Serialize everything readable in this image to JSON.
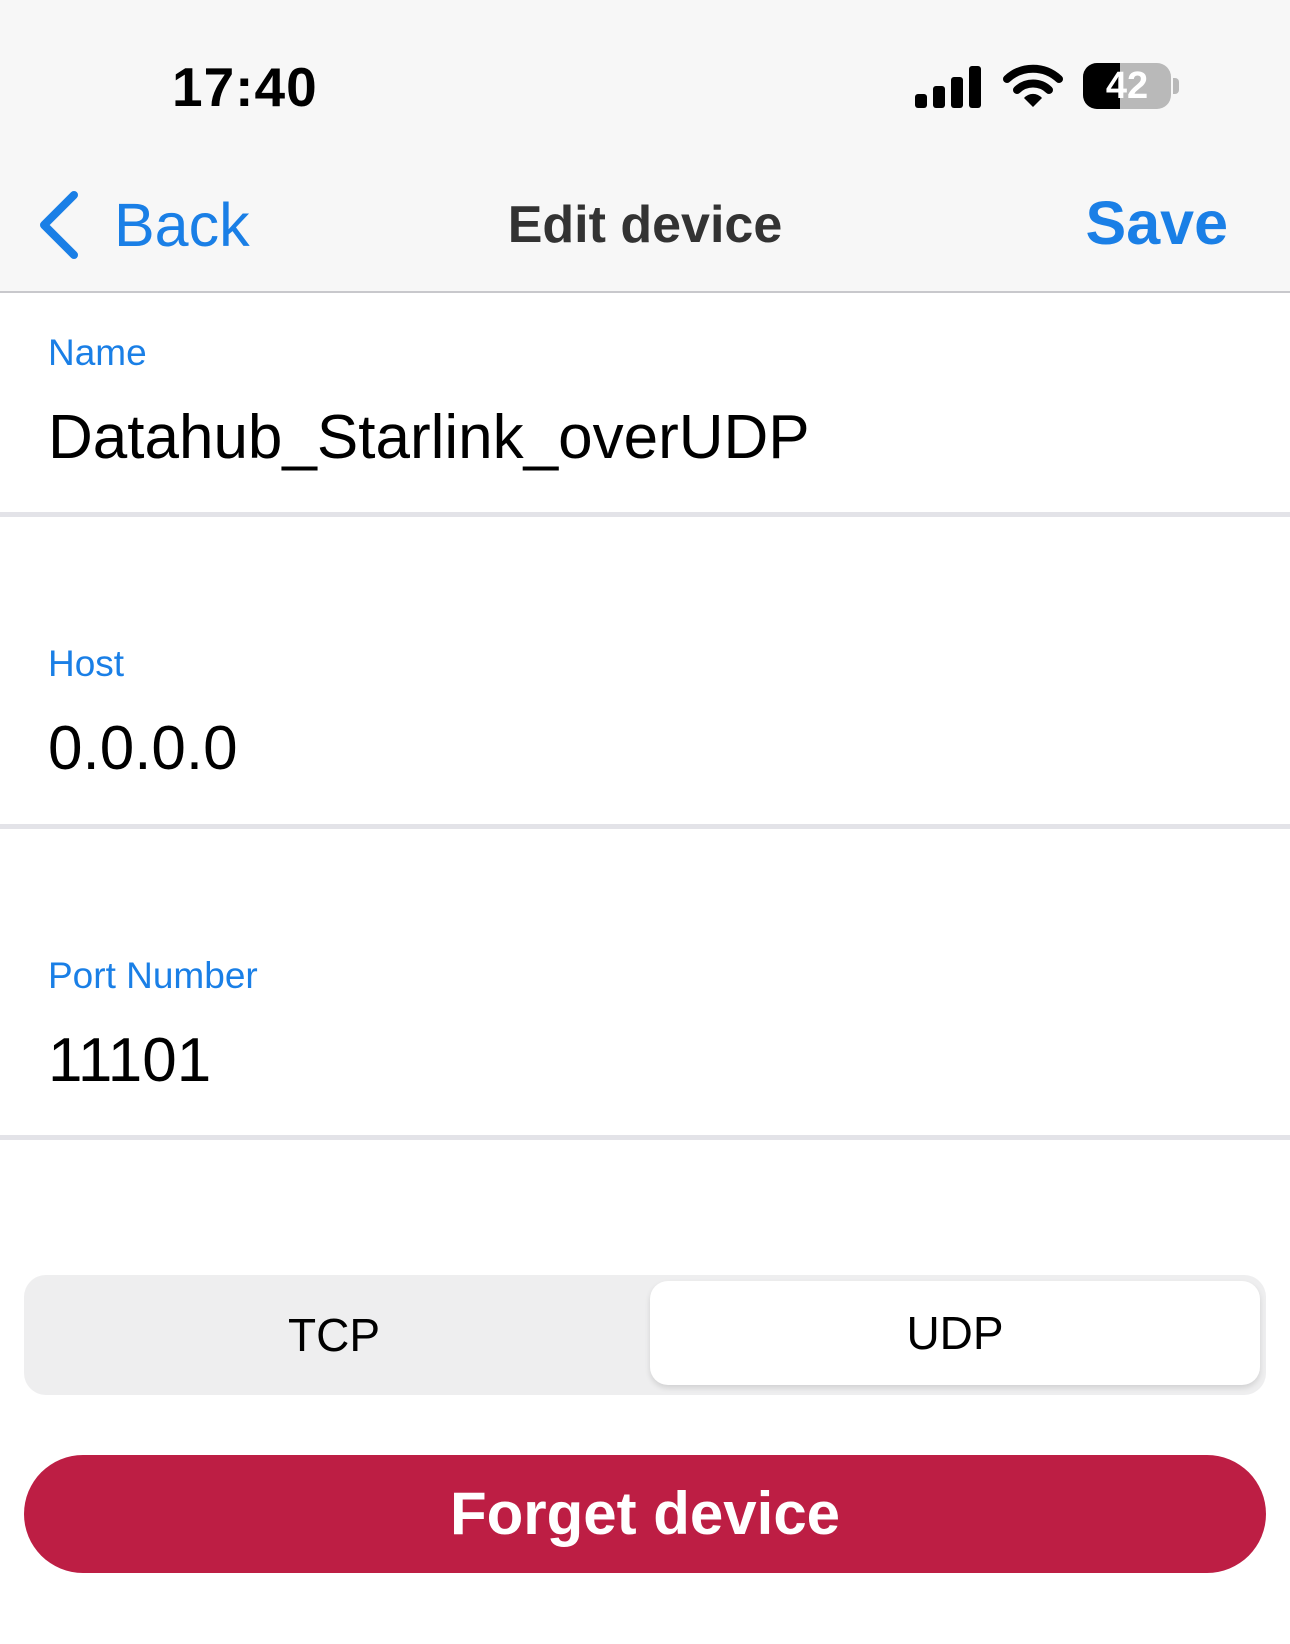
{
  "status_bar": {
    "time": "17:40",
    "battery_level": "42",
    "battery_fraction": 0.42,
    "icons": [
      "signal-icon",
      "wifi-icon",
      "battery-icon"
    ]
  },
  "nav": {
    "back_label": "Back",
    "title": "Edit device",
    "save_label": "Save"
  },
  "form": {
    "name": {
      "label": "Name",
      "value": "Datahub_Starlink_overUDP"
    },
    "host": {
      "label": "Host",
      "value": "0.0.0.0"
    },
    "port": {
      "label": "Port Number",
      "value": "11101"
    }
  },
  "protocol": {
    "options": [
      "TCP",
      "UDP"
    ],
    "selected": "UDP"
  },
  "actions": {
    "forget_label": "Forget device"
  },
  "colors": {
    "accent": "#1a7fe6",
    "destructive": "#bd1e44",
    "nav_background": "#f7f7f7"
  }
}
